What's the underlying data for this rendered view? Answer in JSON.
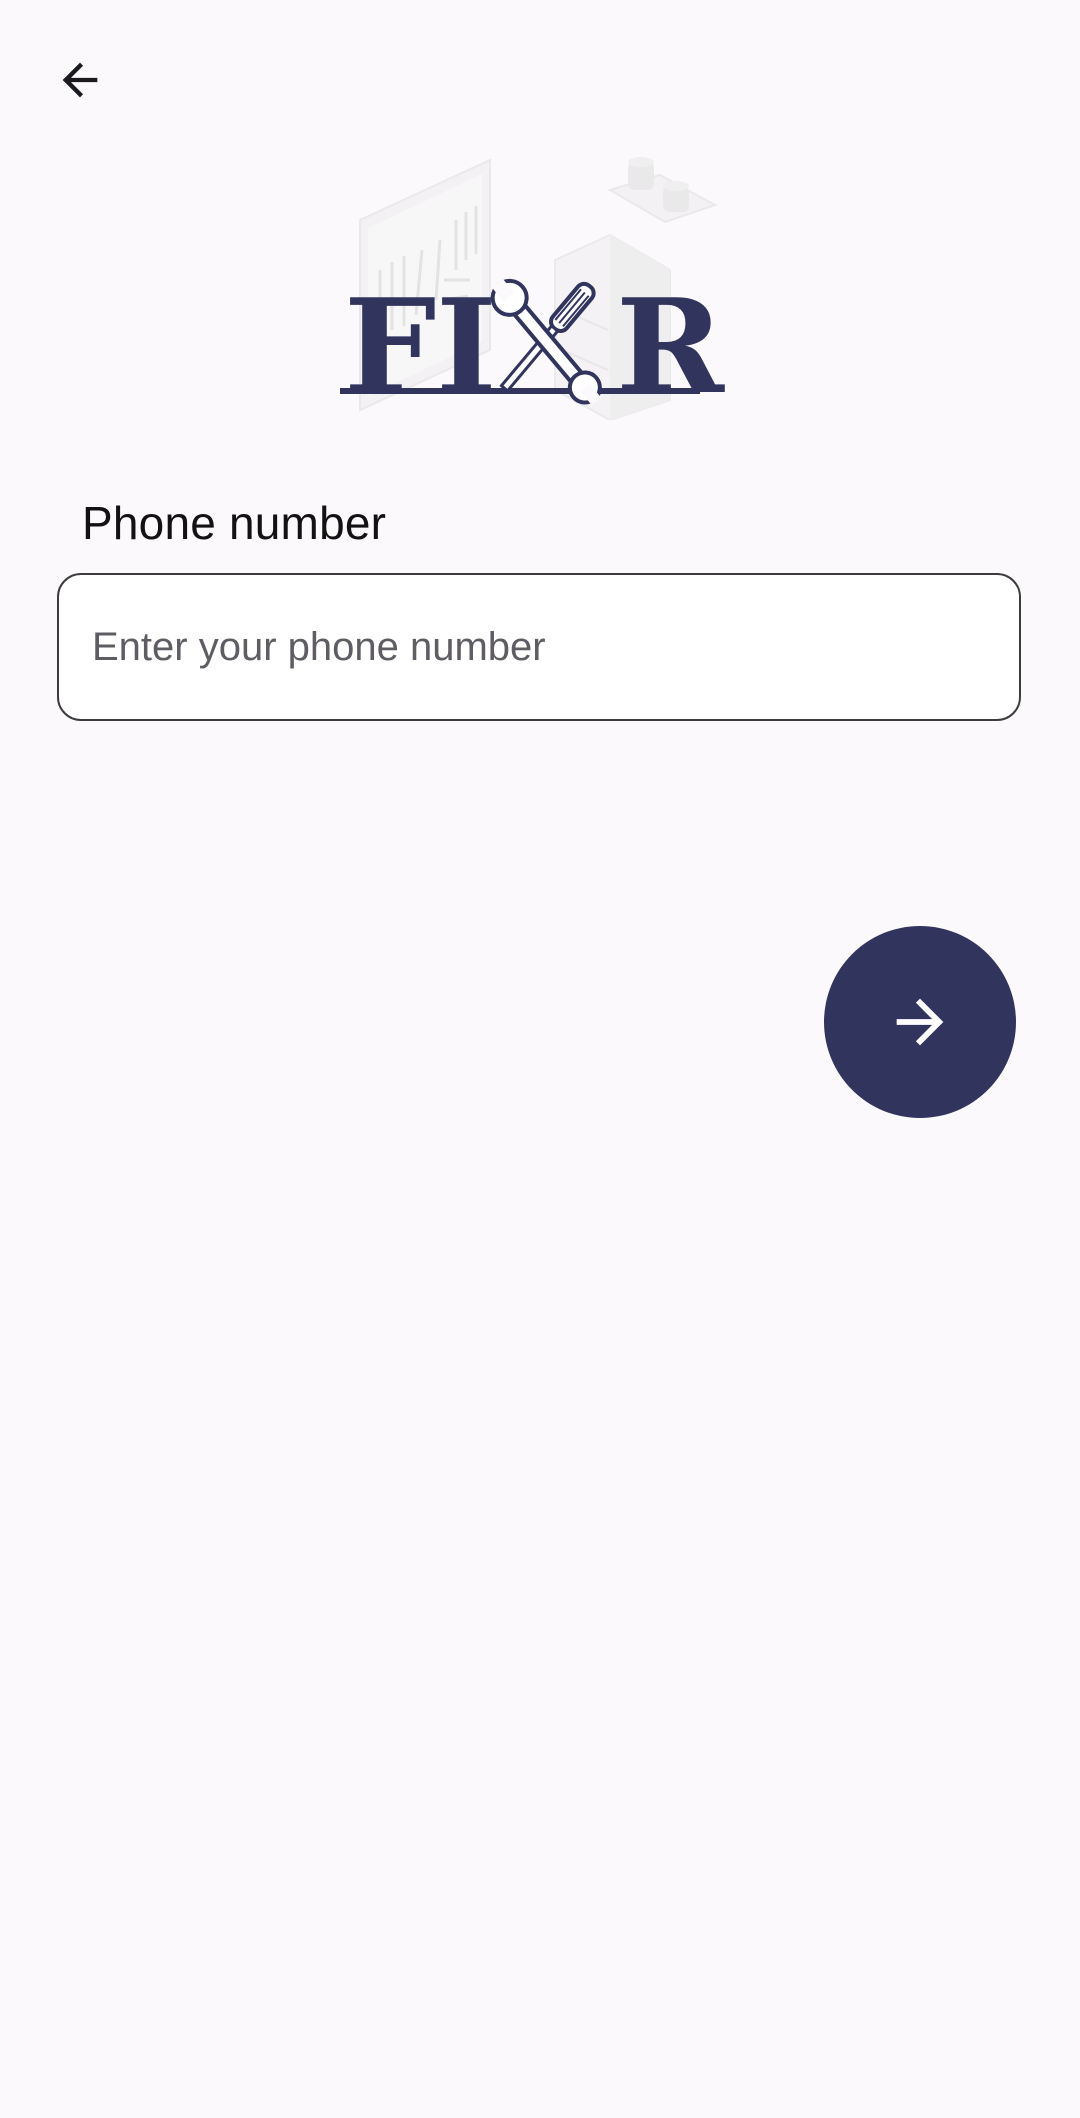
{
  "navigation": {
    "back_icon": "arrow-left-icon"
  },
  "logo": {
    "text": "FIXR",
    "brand_color": "#31355e"
  },
  "form": {
    "phone_label": "Phone number",
    "phone_value": "",
    "phone_placeholder": "Enter your phone number"
  },
  "actions": {
    "next_icon": "arrow-right-icon",
    "next_button_color": "#31355e"
  }
}
